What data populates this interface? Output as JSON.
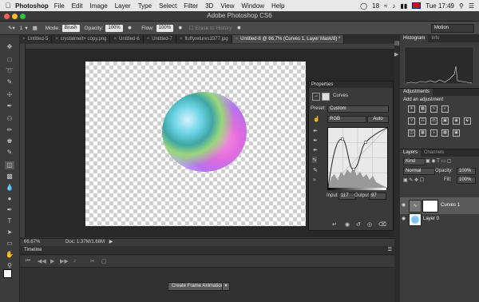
{
  "menubar": {
    "app": "Photoshop",
    "items": [
      "File",
      "Edit",
      "Image",
      "Layer",
      "Type",
      "Select",
      "Filter",
      "3D",
      "View",
      "Window",
      "Help"
    ],
    "right": {
      "notif": "18",
      "time": "Tue 17:49"
    }
  },
  "title": "Adobe Photoshop CS6",
  "options": {
    "mode_label": "Mode:",
    "mode_value": "Brush",
    "opacity_label": "Opacity:",
    "opacity_value": "100%",
    "flow_label": "Flow:",
    "flow_value": "100%",
    "erase_history": "Erase to History",
    "brush_size": "1",
    "workspace": "Motion"
  },
  "tabs": [
    {
      "label": "Untitled-5"
    },
    {
      "label": "crystalmelt+ copy.png"
    },
    {
      "label": "Untitled-6"
    },
    {
      "label": "Untitled-7"
    },
    {
      "label": "fluffyretures3377.jpg"
    },
    {
      "label": "Untitled-8 @ 66.7% (Curves 1, Layer Mask/8) *"
    }
  ],
  "status": {
    "zoom": "66.67%",
    "doc": "Doc: 1.37M/1.68M"
  },
  "timeline": {
    "label": "Timeline",
    "create_button": "Create Frame Animation"
  },
  "properties": {
    "title": "Properties",
    "curves_label": "Curves",
    "preset_label": "Preset:",
    "preset_value": "Custom",
    "channel_value": "RGB",
    "auto_label": "Auto",
    "input_label": "Input:",
    "input_value": "117",
    "output_label": "Output:",
    "output_value": "97"
  },
  "histogram": {
    "tab1": "Histogram",
    "tab2": "Info"
  },
  "adjustments": {
    "tab": "Adjustments",
    "subtitle": "Add an adjustment"
  },
  "layers_panel": {
    "tab1": "Layers",
    "tab2": "Channels",
    "kind_value": "Kind",
    "blend_value": "Normal",
    "opacity_label": "Opacity:",
    "opacity_value": "100%",
    "fill_label": "Fill:",
    "fill_value": "100%",
    "layers": [
      {
        "name": "Curves 1"
      },
      {
        "name": "Layer 0"
      }
    ]
  },
  "colors": {
    "foreground": "#ffffff",
    "background": "#000000"
  }
}
